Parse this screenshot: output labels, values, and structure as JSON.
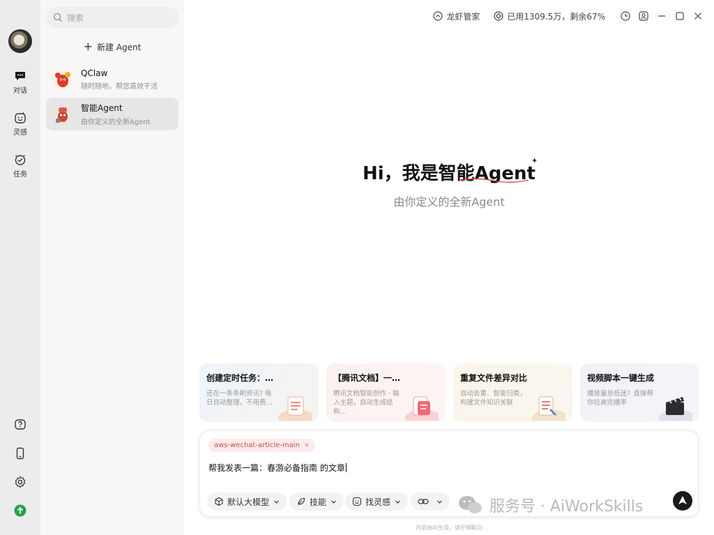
{
  "rail": {
    "items": [
      {
        "label": "对话",
        "icon": "chat-bubble-icon"
      },
      {
        "label": "灵感",
        "icon": "inspiration-face-icon"
      },
      {
        "label": "任务",
        "icon": "task-check-icon"
      }
    ],
    "bottom_icons": [
      "help-icon",
      "phone-icon",
      "settings-gear-icon",
      "upgrade-arrow-icon"
    ]
  },
  "sidebar": {
    "search_placeholder": "搜索",
    "new_agent_label": "新建 Agent",
    "conversations": [
      {
        "title": "QClaw",
        "subtitle": "随时随地，帮您高效干活"
      },
      {
        "title": "智能Agent",
        "subtitle": "由你定义的全新Agent",
        "active": true
      }
    ]
  },
  "topbar": {
    "manager_label": "龙虾管家",
    "usage_label": "已用1309.5万，剩余67%"
  },
  "hero": {
    "title": "Hi，我是智能Agent",
    "subtitle": "由你定义的全新Agent"
  },
  "cards": [
    {
      "title": "创建定时任务：…",
      "desc": "还在一条条刷资讯? 每日自动整理，不用费…"
    },
    {
      "title": "【腾讯文档】一…",
      "desc": "腾讯文档智能创作 · 输入主题，自动生成结构…"
    },
    {
      "title": "重复文件差异对比",
      "desc": "自动去重、智能归类，构建文件知识关联"
    },
    {
      "title": "视频脚本一键生成",
      "desc": "播放量总低迷？直接帮你拉高完播率"
    }
  ],
  "composer": {
    "chip_label": "aws-wechat-article-main",
    "chip_close": "×",
    "prompt_text": "帮我发表一篇：春游必备指南  的文章",
    "tools": [
      {
        "label": "默认大模型",
        "icon": "cube-icon"
      },
      {
        "label": "技能",
        "icon": "leaf-icon"
      },
      {
        "label": "找灵感",
        "icon": "smile-icon"
      },
      {
        "label": "",
        "icon": "link-icon"
      }
    ]
  },
  "footer_text": "内容由AI生成，请仔细甄别",
  "watermark": "服务号 · AiWorkSkills",
  "colors": {
    "chip_bg": "#fdeceb",
    "chip_text": "#c2524b",
    "upgrade": "#22a447"
  }
}
